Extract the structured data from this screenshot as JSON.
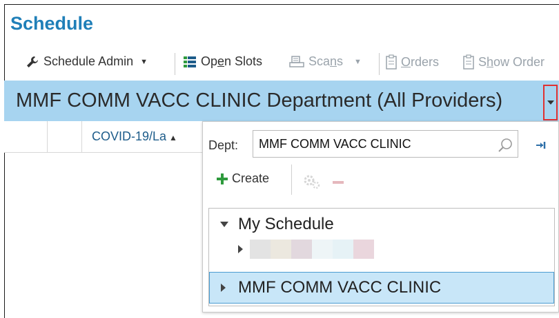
{
  "app": {
    "title": "Schedule"
  },
  "toolbar": {
    "schedule_admin": "Schedule Admin",
    "open_slots_pre": "Op",
    "open_slots_u": "e",
    "open_slots_post": "n Slots",
    "scans_pre": "Sca",
    "scans_u": "n",
    "scans_post": "s",
    "orders_u": "O",
    "orders_post": "rders",
    "show_orders_pre": "S",
    "show_orders_u": "h",
    "show_orders_post": "ow Order"
  },
  "department_bar": {
    "title": "MMF COMM VACC CLINIC Department (All Providers)"
  },
  "column_header": {
    "label": "COVID-19/La"
  },
  "dept_popup": {
    "dept_label": "Dept:",
    "dept_value": "MMF COMM VACC CLINIC",
    "create_label": "Create",
    "tree": {
      "my_schedule": "My Schedule",
      "selected_dept": "MMF COMM VACC CLINIC",
      "blurred_colors": [
        "#e3e3e3",
        "#ece8df",
        "#e2d8de",
        "#eef5f7",
        "#e6f2f6",
        "#ead6dd"
      ]
    }
  },
  "colors": {
    "title": "#1f7fb8",
    "department_bar": "#a7d4f0",
    "highlight_border": "#e03030",
    "create_plus": "#2e9a3d",
    "selected_row": "#c8e6f8"
  }
}
